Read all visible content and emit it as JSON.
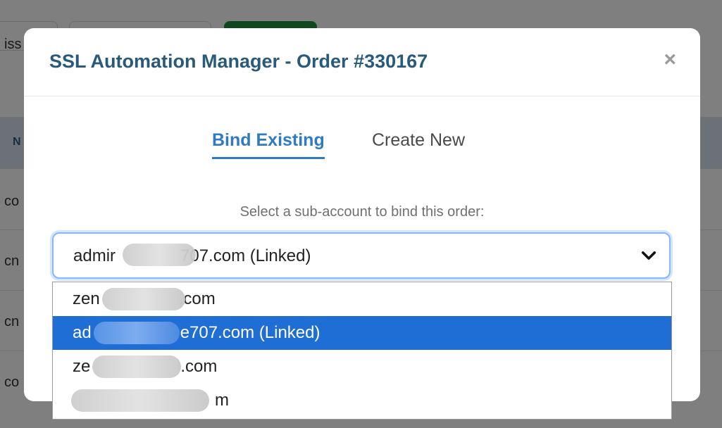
{
  "background": {
    "left_fragments": [
      "iss",
      "N",
      "co",
      "cn",
      "cn",
      "co"
    ]
  },
  "modal": {
    "title": "SSL Automation Manager - Order #330167",
    "close_symbol": "×"
  },
  "tabs": [
    {
      "label": "Bind Existing",
      "active": true
    },
    {
      "label": "Create New",
      "active": false
    }
  ],
  "select": {
    "label": "Select a sub-account to bind this order:",
    "value_prefix": "admir",
    "value_suffix": "707.com (Linked)",
    "options": [
      {
        "prefix": "zen",
        "suffix": ".com",
        "selected": false
      },
      {
        "prefix": "ad",
        "suffix": "e707.com (Linked)",
        "selected": true
      },
      {
        "prefix": "ze",
        "suffix": ".com",
        "selected": false
      },
      {
        "prefix": "",
        "suffix": "m",
        "selected": false
      }
    ]
  },
  "colors": {
    "title": "#2a5a7a",
    "tab_active": "#2f7bc2",
    "option_selected_bg": "#1e6ed6",
    "focus_ring": "#86b7fe"
  },
  "icons": {
    "close": "close-icon",
    "dropdown": "chevron-down-icon"
  }
}
